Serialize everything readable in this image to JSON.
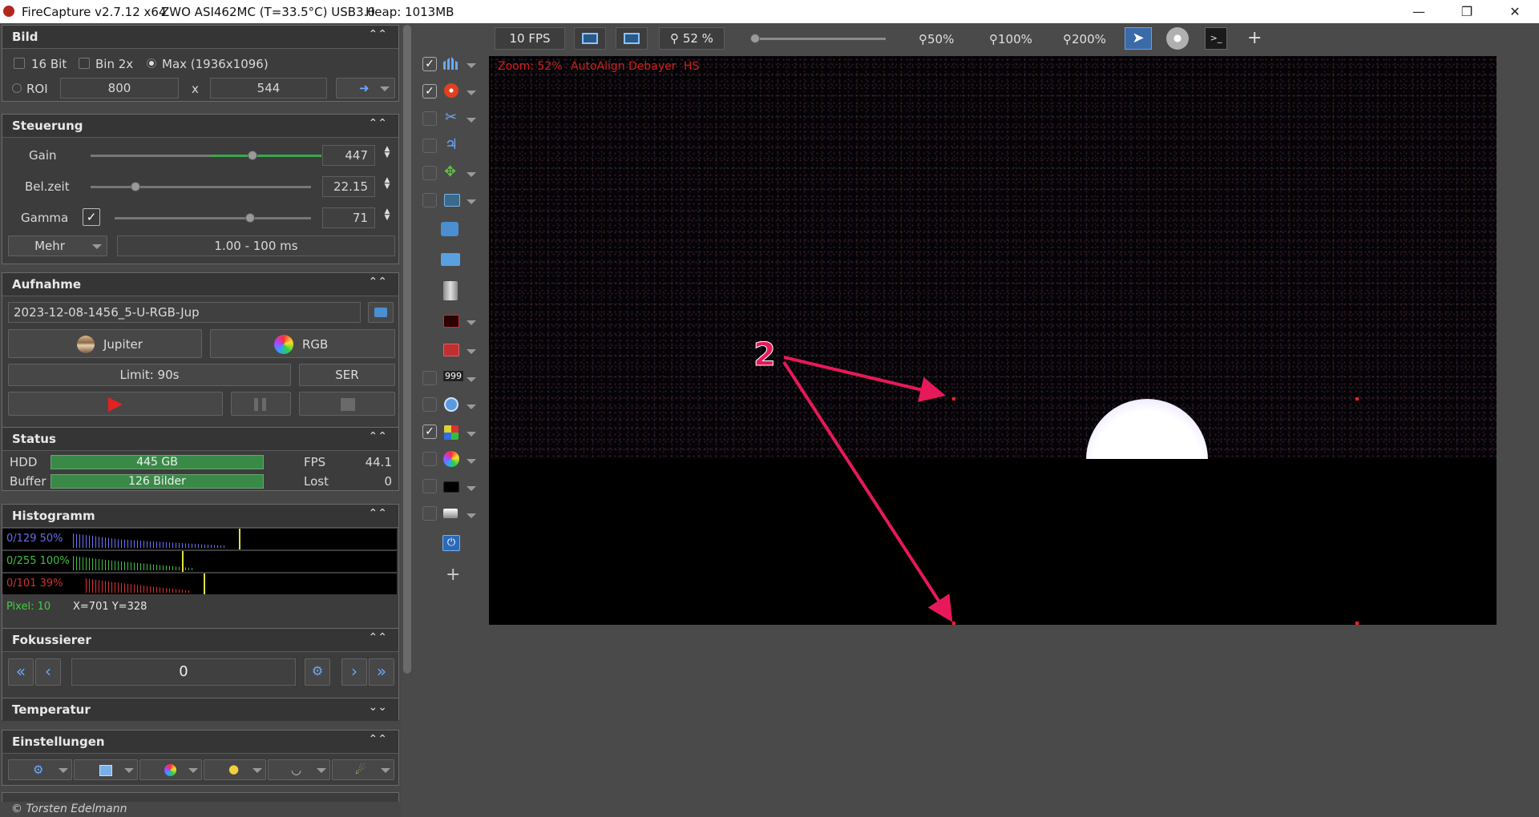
{
  "titlebar": {
    "app": "FireCapture v2.7.12 x64",
    "camera": "ZWO ASI462MC (T=33.5°C) USB3.0",
    "heap": "Heap: 1013MB"
  },
  "panels": {
    "bild": {
      "title": "Bild",
      "bit16": "16 Bit",
      "bin2x": "Bin 2x",
      "max": "Max (1936x1096)",
      "roi": "ROI",
      "roi_w": "800",
      "x": "x",
      "roi_h": "544"
    },
    "steuerung": {
      "title": "Steuerung",
      "gain_label": "Gain",
      "gain_value": "447",
      "belzeit_label": "Bel.zeit",
      "belzeit_value": "22.15",
      "gamma_label": "Gamma",
      "gamma_value": "71",
      "mehr": "Mehr",
      "range": "1.00 - 100 ms"
    },
    "aufnahme": {
      "title": "Aufnahme",
      "filename": "2023-12-08-1456_5-U-RGB-Jup",
      "object": "Jupiter",
      "filter": "RGB",
      "limit": "Limit: 90s",
      "format": "SER"
    },
    "status": {
      "title": "Status",
      "hdd_label": "HDD",
      "hdd_value": "445 GB",
      "fps_label": "FPS",
      "fps_value": "44.1",
      "buffer_label": "Buffer",
      "buffer_value": "126 Bilder",
      "lost_label": "Lost",
      "lost_value": "0"
    },
    "histogramm": {
      "title": "Histogramm",
      "blue": "0/129 50%",
      "green": "0/255 100%",
      "red": "0/101 39%",
      "pixel": "Pixel: 10",
      "coords": "X=701 Y=328"
    },
    "fokussierer": {
      "title": "Fokussierer",
      "position": "0"
    },
    "temperatur": {
      "title": "Temperatur"
    },
    "einstellungen": {
      "title": "Einstellungen"
    }
  },
  "footer": "© Torsten Edelmann",
  "topbar": {
    "fps": "10 FPS",
    "zoom": "52 %",
    "z50": "50%",
    "z100": "100%",
    "z200": "200%",
    "plus": "+"
  },
  "viewer": {
    "zoom": "Zoom: 52%",
    "autoalign": "AutoAlign",
    "debayer": "Debayer",
    "hs": "HS",
    "annotation": "2"
  },
  "colors": {
    "accent_green": "#3a8a47",
    "viewer_label_red": "#d0201c",
    "annotation_pink": "#e8195a"
  }
}
